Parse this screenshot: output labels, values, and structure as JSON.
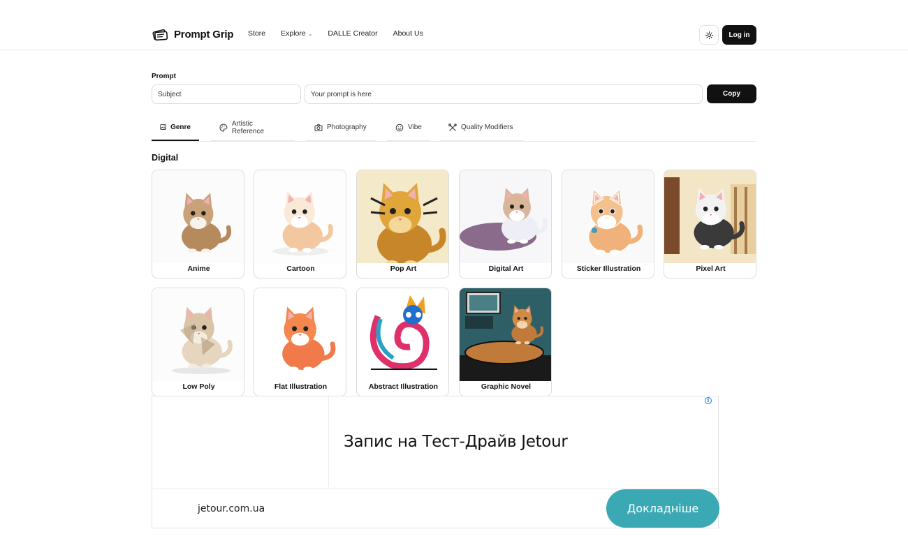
{
  "header": {
    "brand_name": "Prompt Grip",
    "nav": [
      {
        "label": "Store"
      },
      {
        "label": "Explore",
        "has_dropdown": true
      },
      {
        "label": "DALLE Creator"
      },
      {
        "label": "About Us"
      }
    ],
    "theme_icon": "sun-icon",
    "login_label": "Log in"
  },
  "prompt": {
    "label": "Prompt",
    "subject_placeholder": "Subject",
    "prompt_placeholder": "Your prompt is here",
    "copy_label": "Copy"
  },
  "tabs": [
    {
      "label": "Genre",
      "icon": "image-gallery-icon",
      "active": true
    },
    {
      "label": "Artistic Reference",
      "icon": "palette-icon",
      "active": false
    },
    {
      "label": "Photography",
      "icon": "camera-icon",
      "active": false
    },
    {
      "label": "Vibe",
      "icon": "smile-icon",
      "active": false
    },
    {
      "label": "Quality Modifiers",
      "icon": "tools-icon",
      "active": false
    }
  ],
  "section": {
    "title": "Digital",
    "cards": [
      {
        "label": "Anime"
      },
      {
        "label": "Cartoon"
      },
      {
        "label": "Pop Art"
      },
      {
        "label": "Digital Art"
      },
      {
        "label": "Sticker Illustration"
      },
      {
        "label": "Pixel Art"
      },
      {
        "label": "Low Poly"
      },
      {
        "label": "Flat Illustration"
      },
      {
        "label": "Abstract Illustration"
      },
      {
        "label": "Graphic Novel"
      }
    ]
  },
  "ad": {
    "headline": "Запис на Тест-Драйв Jetour",
    "domain": "jetour.com.ua",
    "cta": "Докладніше",
    "cta_color": "#3aa9b4"
  }
}
